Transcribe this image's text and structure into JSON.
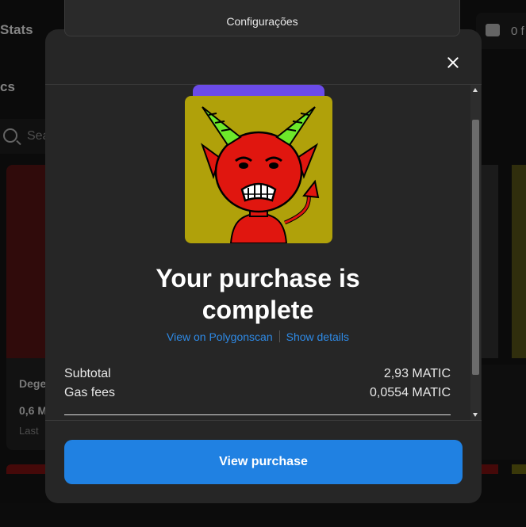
{
  "background": {
    "nav_stats": "Stats",
    "nav_ics": "cs",
    "search_placeholder": "Sea",
    "card_name": "Dege",
    "card_price": "0,6 M",
    "card_last": "Last",
    "wallet_value": "0 f",
    "wallet_icon": "wallet-icon",
    "search_icon": "search-icon"
  },
  "dropdown": {
    "label": "Configurações"
  },
  "modal": {
    "close_icon": "close-icon",
    "headline_line1": "Your purchase is",
    "headline_line2": "complete",
    "links": {
      "polygonscan": "View on Polygonscan",
      "details": "Show details"
    },
    "summary": [
      {
        "label": "Subtotal",
        "value": "2,93 MATIC"
      },
      {
        "label": "Gas fees",
        "value": "0,0554 MATIC"
      }
    ],
    "primary_button": "View purchase"
  },
  "colors": {
    "accent": "#2081e2",
    "link": "#2e8ae6",
    "modal_bg": "#262626",
    "nft_bg": "#b0a10a",
    "tab_purple": "#6b4be8"
  }
}
